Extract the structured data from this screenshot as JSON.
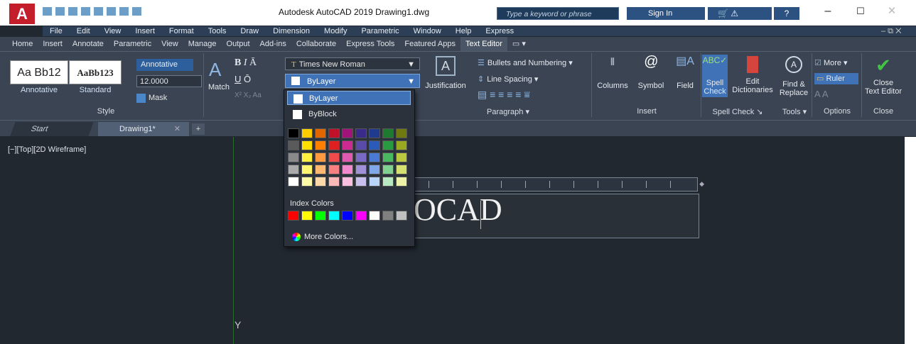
{
  "app": {
    "logo_letter": "A",
    "title": "Autodesk AutoCAD 2019    Drawing1.dwg",
    "search_placeholder": "Type a keyword or phrase",
    "sign_in": "Sign In",
    "window_min": "–",
    "window_max": "☐",
    "window_close": "✕",
    "help": "?"
  },
  "menubar": [
    "File",
    "Edit",
    "View",
    "Insert",
    "Format",
    "Tools",
    "Draw",
    "Dimension",
    "Modify",
    "Parametric",
    "Window",
    "Help",
    "Express"
  ],
  "ribbon_tabs": [
    {
      "label": "Home"
    },
    {
      "label": "Insert"
    },
    {
      "label": "Annotate"
    },
    {
      "label": "Parametric"
    },
    {
      "label": "View"
    },
    {
      "label": "Manage"
    },
    {
      "label": "Output"
    },
    {
      "label": "Add-ins"
    },
    {
      "label": "Collaborate"
    },
    {
      "label": "Express Tools"
    },
    {
      "label": "Featured Apps"
    },
    {
      "label": "Text Editor",
      "active": true
    }
  ],
  "style_panel": {
    "title": "Style",
    "style1_preview": "Aa Bb12",
    "style1_label": "Annotative",
    "style2_preview": "AaBb123",
    "style2_label": "Standard",
    "annotative_btn": "Annotative",
    "text_height": "12.0000",
    "mask_btn": "Mask"
  },
  "formatting": {
    "match_label": "Match",
    "font": "Times New Roman",
    "color": "ByLayer"
  },
  "color_dropdown": {
    "items": [
      "ByLayer",
      "ByBlock"
    ],
    "index_label": "Index Colors",
    "more_colors": "More Colors...",
    "standard_rows": [
      [
        "#000000",
        "#ffcc00",
        "#e06600",
        "#c0102a",
        "#a0147a",
        "#3a2a8a",
        "#1f3a8f",
        "#1e7a30",
        "#6e7a10"
      ],
      [
        "#5a5a5a",
        "#ffe000",
        "#ff8000",
        "#e02020",
        "#cc2a90",
        "#5a4aaa",
        "#2a5aba",
        "#2a9a40",
        "#9aaa20"
      ],
      [
        "#8a8a8a",
        "#fff040",
        "#ff9a40",
        "#f04a4a",
        "#e05ab0",
        "#7a6ac6",
        "#4a7ad4",
        "#4ab860",
        "#bac840"
      ],
      [
        "#aaaaaa",
        "#fff570",
        "#ffb870",
        "#f88080",
        "#f08acc",
        "#a090d8",
        "#80a8e8",
        "#80d090",
        "#d4e070"
      ],
      [
        "#ffffff",
        "#fffaa8",
        "#ffd8a8",
        "#fab8b8",
        "#f8c0e0",
        "#c8c0ec",
        "#b8d4f8",
        "#b8e8c0",
        "#ecf2a8"
      ]
    ],
    "index_colors": [
      "#ff0000",
      "#ffff00",
      "#00ff00",
      "#00ffff",
      "#0000ff",
      "#ff00ff",
      "#ffffff",
      "#808080",
      "#c0c0c0"
    ]
  },
  "paragraph_panel": {
    "title": "Paragraph",
    "justification": "Justification",
    "bullets": "Bullets and Numbering",
    "line_spacing": "Line Spacing"
  },
  "insert_panel": {
    "title": "Insert",
    "columns": "Columns",
    "symbol": "Symbol",
    "field": "Field"
  },
  "spell_panel": {
    "title": "Spell Check",
    "spell_check": [
      "Spell",
      "Check"
    ],
    "edit_dictionaries": [
      "Edit",
      "Dictionaries"
    ]
  },
  "tools_panel": {
    "title": "Tools",
    "find_replace": [
      "Find &",
      "Replace"
    ]
  },
  "options_panel": {
    "title": "Options",
    "more": "More",
    "ruler": "Ruler"
  },
  "close_panel": {
    "title": "Close",
    "close_editor": [
      "Close",
      "Text Editor"
    ]
  },
  "file_tabs": {
    "start": "Start",
    "drawing": "Drawing1*",
    "plus": "+"
  },
  "viewport": {
    "label": "[−][Top][2D Wireframe]",
    "mtext_visible": "OCAD",
    "axis_label": "Y"
  }
}
